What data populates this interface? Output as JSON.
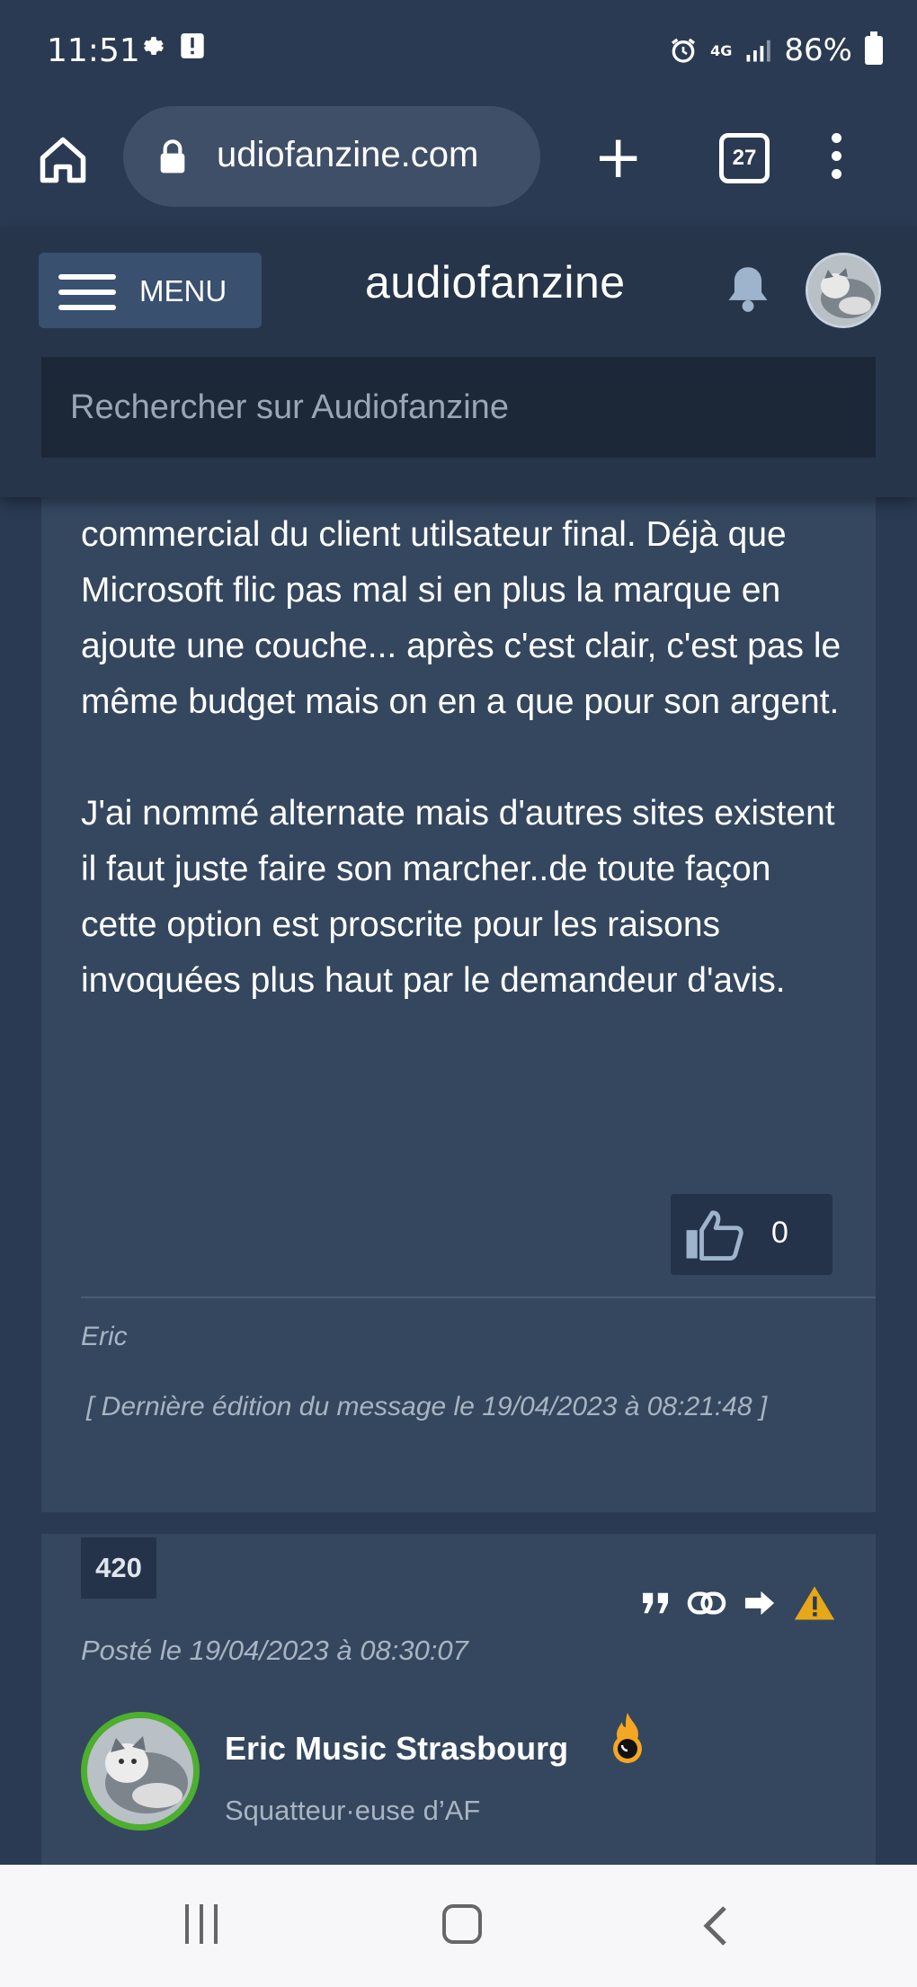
{
  "status_bar": {
    "time": "11:51",
    "network": "4G",
    "battery": "86%"
  },
  "browser": {
    "url": "udiofanzine.com",
    "tab_count": "27"
  },
  "site_header": {
    "menu_label": "MENU",
    "logo": "audiofanzine",
    "search_placeholder": "Rechercher sur Audiofanzine"
  },
  "post_1": {
    "paragraph_1": "commercial du client utilsateur final. Déjà que Microsoft flic pas mal si en plus la marque en ajoute une couche... après c'est clair, c'est pas le même budget mais on en a que pour son argent.",
    "paragraph_2": "J'ai nommé alternate mais d'autres sites existent il faut juste faire son marcher..de toute façon cette option est proscrite pour les raisons invoquées plus haut par le demandeur d'avis.",
    "likes": "0",
    "signature": "Eric",
    "edit_note": "[ Dernière édition du message le 19/04/2023 à 08:21:48 ]"
  },
  "post_2": {
    "number": "420",
    "posted": "Posté le 19/04/2023 à 08:30:07",
    "author_name": "Eric Music Strasbourg",
    "author_rank": "Squatteur·euse d’AF",
    "actions": [
      "quote-icon",
      "link-icon",
      "arrow-right-icon",
      "warning-icon"
    ]
  },
  "colors": {
    "background": "#2a3a52",
    "card": "#34475f",
    "accent_green": "#4caf2e",
    "warning": "#e6a817"
  }
}
